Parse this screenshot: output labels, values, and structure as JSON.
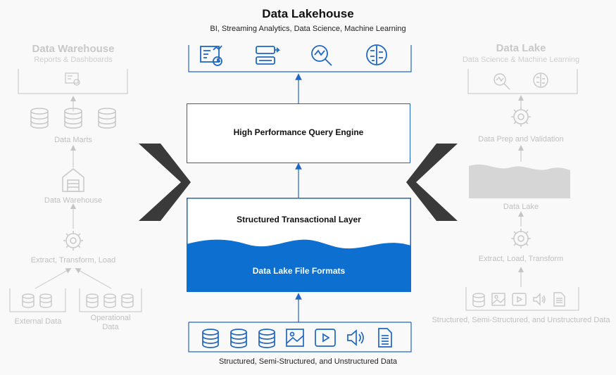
{
  "lakehouse": {
    "title": "Data Lakehouse",
    "subtitle": "BI, Streaming Analytics, Data Science, Machine Learning",
    "query_engine": "High Performance Query Engine",
    "transactional_layer": "Structured Transactional Layer",
    "file_formats": "Data Lake File Formats",
    "sources_label": "Structured, Semi-Structured, and Unstructured Data",
    "top_icons": [
      "bi-dashboard-icon",
      "streaming-data-icon",
      "data-science-analysis-icon",
      "machine-learning-brain-icon"
    ],
    "source_icons": [
      "database-icon",
      "database-icon",
      "database-icon",
      "image-icon",
      "video-icon",
      "audio-icon",
      "document-icon"
    ]
  },
  "warehouse": {
    "title": "Data Warehouse",
    "subtitle": "Reports & Dashboards",
    "data_marts": "Data Marts",
    "data_warehouse": "Data Warehouse",
    "etl": "Extract, Transform, Load",
    "external_data": "External Data",
    "operational_data": "Operational\nData"
  },
  "lake": {
    "title": "Data Lake",
    "subtitle": "Data Science & Machine Learning",
    "prep": "Data Prep and Validation",
    "data_lake": "Data Lake",
    "elt": "Extract, Load, Transform",
    "sources_label": "Structured, Semi-Structured, and Unstructured Data"
  },
  "colors": {
    "accent_blue": "#1f67c2",
    "wave_blue": "#0d6fd0",
    "faded_gray": "#c4c4c4",
    "chevron": "#3a3a3a"
  }
}
